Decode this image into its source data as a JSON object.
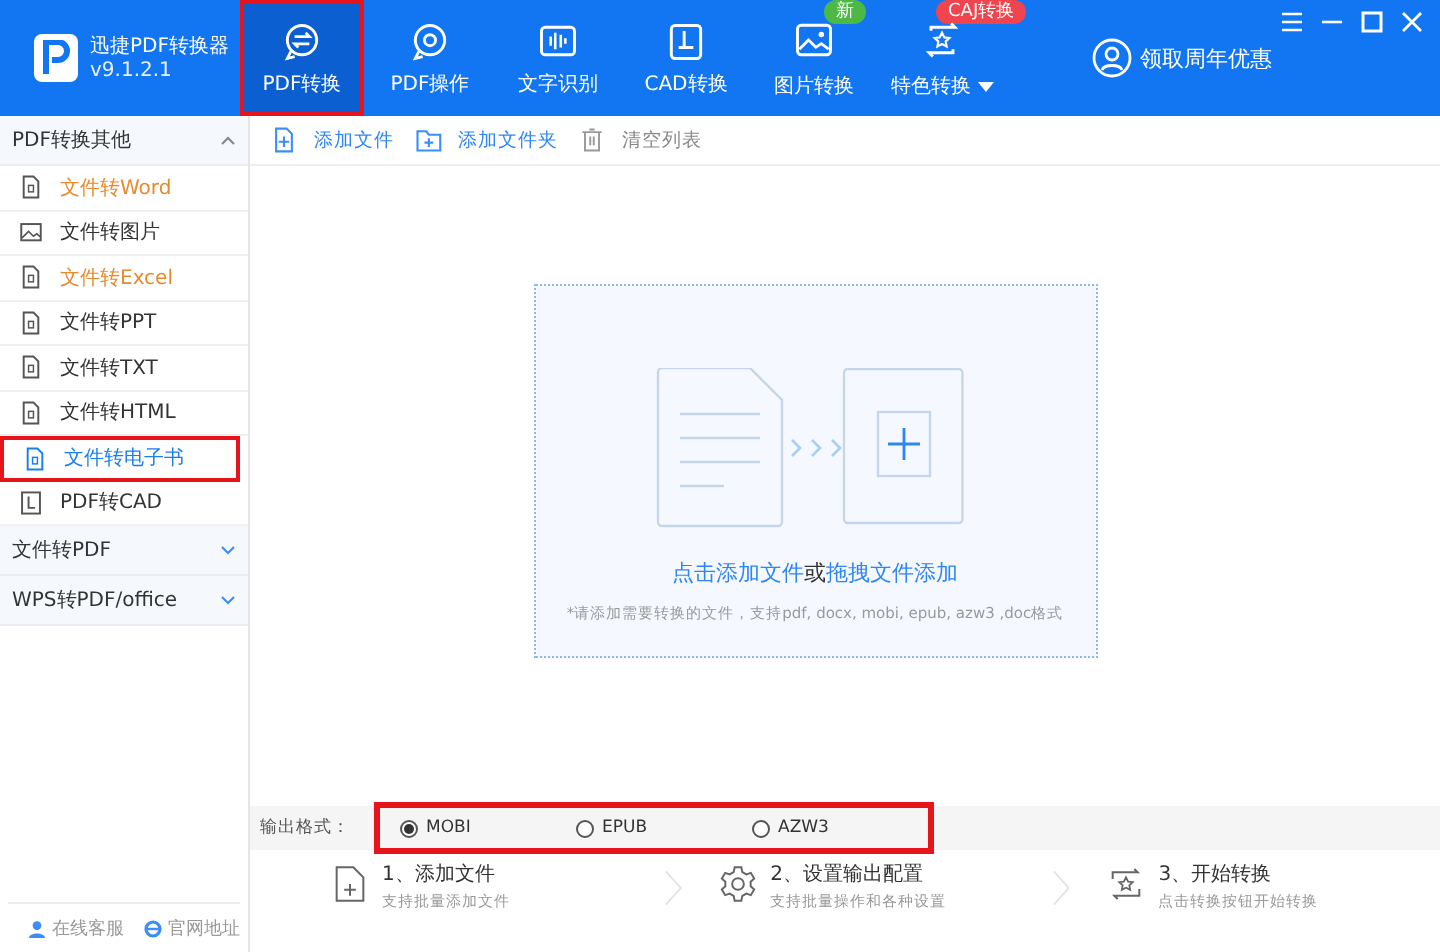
{
  "app": {
    "name": "迅捷PDF转换器",
    "version": "v9.1.2.1"
  },
  "tabs": [
    {
      "label": "PDF转换",
      "selected": true,
      "highlighted": true
    },
    {
      "label": "PDF操作",
      "selected": false,
      "highlighted": false
    },
    {
      "label": "文字识别",
      "selected": false,
      "highlighted": false
    },
    {
      "label": "CAD转换",
      "selected": false,
      "highlighted": false
    },
    {
      "label": "图片转换",
      "selected": false,
      "highlighted": false,
      "badge": {
        "text": "新",
        "color": "#4cb944"
      }
    },
    {
      "label": "特色转换",
      "selected": false,
      "highlighted": false,
      "dropdown": true,
      "badge": {
        "text": "CAJ转换",
        "color": "#f0454f"
      }
    }
  ],
  "promo": "领取周年优惠",
  "sidebar": {
    "groups": [
      {
        "label": "PDF转换其他",
        "expanded": true,
        "items": [
          {
            "label": "文件转Word",
            "kind": "doc",
            "accent": true,
            "selected": false,
            "highlighted": false
          },
          {
            "label": "文件转图片",
            "kind": "image",
            "accent": false,
            "selected": false,
            "highlighted": false
          },
          {
            "label": "文件转Excel",
            "kind": "doc",
            "accent": true,
            "selected": false,
            "highlighted": false
          },
          {
            "label": "文件转PPT",
            "kind": "doc",
            "accent": false,
            "selected": false,
            "highlighted": false
          },
          {
            "label": "文件转TXT",
            "kind": "doc",
            "accent": false,
            "selected": false,
            "highlighted": false
          },
          {
            "label": "文件转HTML",
            "kind": "doc",
            "accent": false,
            "selected": false,
            "highlighted": false
          },
          {
            "label": "文件转电子书",
            "kind": "doc",
            "accent": false,
            "selected": true,
            "highlighted": true
          },
          {
            "label": "PDF转CAD",
            "kind": "cad",
            "accent": false,
            "selected": false,
            "highlighted": false
          }
        ]
      },
      {
        "label": "文件转PDF",
        "expanded": false
      },
      {
        "label": "WPS转PDF/office",
        "expanded": false
      }
    ],
    "links": [
      "在线客服",
      "官网地址"
    ]
  },
  "toolbar": [
    {
      "label": "添加文件",
      "disabled": false
    },
    {
      "label": "添加文件夹",
      "disabled": false
    },
    {
      "label": "清空列表",
      "disabled": true
    }
  ],
  "dropzone": {
    "link1": "点击添加文件",
    "or": "或",
    "link2": "拖拽文件添加",
    "hint": "*请添加需要转换的文件，支持pdf, docx, mobi, epub, azw3 ,doc格式"
  },
  "output_format": {
    "label": "输出格式：",
    "highlighted": true,
    "options": [
      {
        "label": "MOBI",
        "selected": true
      },
      {
        "label": "EPUB",
        "selected": false
      },
      {
        "label": "AZW3",
        "selected": false
      }
    ]
  },
  "steps": [
    {
      "title": "1、添加文件",
      "subtitle": "支持批量添加文件"
    },
    {
      "title": "2、设置输出配置",
      "subtitle": "支持批量操作和各种设置"
    },
    {
      "title": "3、开始转换",
      "subtitle": "点击转换按钮开始转换"
    }
  ]
}
